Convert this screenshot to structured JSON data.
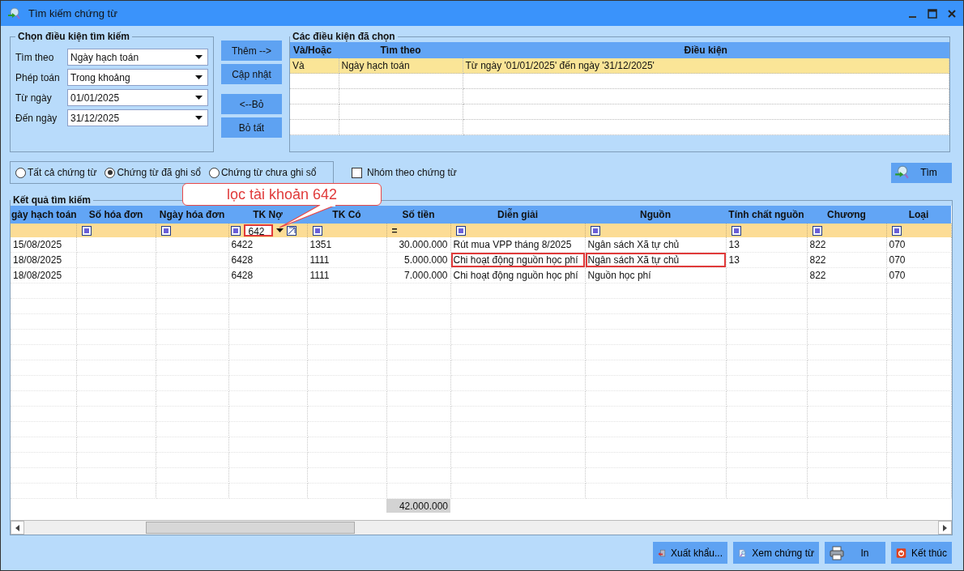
{
  "window": {
    "title": "Tìm kiếm chứng từ"
  },
  "criteria": {
    "title": "Chọn điều kiện tìm kiếm",
    "fields": [
      {
        "label": "Tìm theo",
        "value": "Ngày hạch toán"
      },
      {
        "label": "Phép toán",
        "value": "Trong khoảng"
      },
      {
        "label": "Từ ngày",
        "value": "01/01/2025"
      },
      {
        "label": "Đến ngày",
        "value": "31/12/2025"
      }
    ]
  },
  "action_buttons": [
    {
      "label": "Thêm -->"
    },
    {
      "label": "Cập nhật"
    },
    {
      "label": "<--Bỏ"
    },
    {
      "label": "Bỏ tất"
    }
  ],
  "chosen": {
    "title": "Các điều kiện đã chọn",
    "columns": [
      "Và/Hoặc",
      "Tìm theo",
      "Điều kiện"
    ],
    "rows": [
      {
        "cells": [
          "Và",
          "Ngày hạch toán",
          "Từ ngày '01/01/2025' đến ngày '31/12/2025'"
        ],
        "selected": true
      }
    ]
  },
  "radios": [
    {
      "label": "Tất cả chứng từ",
      "selected": false
    },
    {
      "label": "Chứng từ đã ghi sổ",
      "selected": true
    },
    {
      "label": "Chứng từ chưa ghi sổ",
      "selected": false
    }
  ],
  "group_checkbox": {
    "label": "Nhóm theo chứng từ",
    "checked": false
  },
  "search_button": {
    "label": "Tìm"
  },
  "results": {
    "title": "Kết quả tìm kiếm",
    "columns": [
      "gày hạch toán",
      "Số hóa đơn",
      "Ngày hóa đơn",
      "TK Nợ",
      "TK Có",
      "Số tiền",
      "Diễn giải",
      "Nguồn",
      "Tính chất nguồn",
      "Chương",
      "Loại"
    ],
    "filters": [
      {
        "kind": "blank",
        "marked": false
      },
      {
        "kind": "icon",
        "marked": false
      },
      {
        "kind": "icon",
        "marked": false
      },
      {
        "kind": "value",
        "value": "642",
        "marked": true
      },
      {
        "kind": "icon",
        "marked": false
      },
      {
        "kind": "operator",
        "symbol": "=",
        "marked": false
      },
      {
        "kind": "icon",
        "marked": false
      },
      {
        "kind": "icon",
        "marked": false
      },
      {
        "kind": "icon",
        "marked": false
      },
      {
        "kind": "icon",
        "marked": false
      },
      {
        "kind": "icon",
        "marked": false
      }
    ],
    "rows": [
      {
        "cells": [
          {
            "text": "15/08/2025",
            "marked": false
          },
          {
            "marked": false
          },
          {
            "marked": false
          },
          {
            "text": "6422",
            "marked": false
          },
          {
            "text": "1351",
            "marked": false
          },
          {
            "text": "30.000.000",
            "marked": false
          },
          {
            "text": "Rút mua VPP tháng 8/2025",
            "marked": false
          },
          {
            "text": "Ngân sách Xã tự chủ",
            "marked": false
          },
          {
            "text": "13",
            "marked": false
          },
          {
            "text": "822",
            "marked": false
          },
          {
            "text": "070",
            "marked": false
          }
        ]
      },
      {
        "cells": [
          {
            "text": "18/08/2025",
            "marked": false
          },
          {
            "marked": false
          },
          {
            "marked": false
          },
          {
            "text": "6428",
            "marked": false
          },
          {
            "text": "1111",
            "marked": false
          },
          {
            "text": "5.000.000",
            "marked": false
          },
          {
            "text": "Chi hoạt động nguồn học phí",
            "marked": true
          },
          {
            "text": "Ngân sách Xã tự chủ",
            "marked": true
          },
          {
            "text": "13",
            "marked": false
          },
          {
            "text": "822",
            "marked": false
          },
          {
            "text": "070",
            "marked": false
          }
        ]
      },
      {
        "cells": [
          {
            "text": "18/08/2025",
            "marked": false
          },
          {
            "marked": false
          },
          {
            "marked": false
          },
          {
            "text": "6428",
            "marked": false
          },
          {
            "text": "1111",
            "marked": false
          },
          {
            "text": "7.000.000",
            "marked": false
          },
          {
            "text": "Chi hoạt động nguồn học phí",
            "marked": false
          },
          {
            "text": "Nguồn học phí",
            "marked": false
          },
          {
            "marked": false
          },
          {
            "text": "822",
            "marked": false
          },
          {
            "text": "070",
            "marked": false
          }
        ]
      }
    ],
    "total": "42.000.000"
  },
  "callout": {
    "text": "lọc tài khoản 642"
  },
  "bottom_buttons": [
    {
      "label": "Xuất khẩu...",
      "kind": "export"
    },
    {
      "label": "Xem chứng từ",
      "kind": "view"
    },
    {
      "label": "In",
      "kind": "print"
    },
    {
      "label": "Kết thúc",
      "kind": "exit"
    }
  ]
}
